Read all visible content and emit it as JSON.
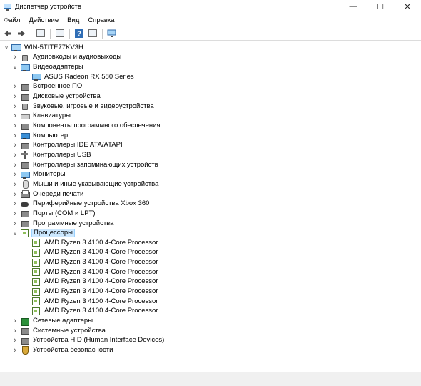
{
  "window": {
    "title": "Диспетчер устройств"
  },
  "menu": [
    "Файл",
    "Действие",
    "Вид",
    "Справка"
  ],
  "tree": {
    "root": "WIN-5TITE77KV3H",
    "items": [
      {
        "label": "Аудиовходы и аудиовыходы",
        "icon": "speaker-icon",
        "expanded": false,
        "level": 1
      },
      {
        "label": "Видеоадаптеры",
        "icon": "display-adapter-icon",
        "expanded": true,
        "level": 1
      },
      {
        "label": "ASUS Radeon RX 580 Series",
        "icon": "display-adapter-icon",
        "level": 2
      },
      {
        "label": "Встроенное ПО",
        "icon": "firmware-icon",
        "expanded": false,
        "level": 1
      },
      {
        "label": "Дисковые устройства",
        "icon": "disk-drive-icon",
        "expanded": false,
        "level": 1
      },
      {
        "label": "Звуковые, игровые и видеоустройства",
        "icon": "speaker-icon",
        "expanded": false,
        "level": 1
      },
      {
        "label": "Клавиатуры",
        "icon": "keyboard-icon",
        "expanded": false,
        "level": 1
      },
      {
        "label": "Компоненты программного обеспечения",
        "icon": "software-component-icon",
        "expanded": false,
        "level": 1
      },
      {
        "label": "Компьютер",
        "icon": "computer-icon",
        "expanded": false,
        "level": 1
      },
      {
        "label": "Контроллеры IDE ATA/ATAPI",
        "icon": "ide-controller-icon",
        "expanded": false,
        "level": 1
      },
      {
        "label": "Контроллеры USB",
        "icon": "usb-icon",
        "expanded": false,
        "level": 1
      },
      {
        "label": "Контроллеры запоминающих устройств",
        "icon": "storage-controller-icon",
        "expanded": false,
        "level": 1
      },
      {
        "label": "Мониторы",
        "icon": "monitor-icon",
        "expanded": false,
        "level": 1
      },
      {
        "label": "Мыши и иные указывающие устройства",
        "icon": "mouse-icon",
        "expanded": false,
        "level": 1
      },
      {
        "label": "Очереди печати",
        "icon": "printer-icon",
        "expanded": false,
        "level": 1
      },
      {
        "label": "Периферийные устройства Xbox 360",
        "icon": "gamepad-icon",
        "expanded": false,
        "level": 1
      },
      {
        "label": "Порты (COM и LPT)",
        "icon": "port-icon",
        "expanded": false,
        "level": 1
      },
      {
        "label": "Программные устройства",
        "icon": "software-device-icon",
        "expanded": false,
        "level": 1
      },
      {
        "label": "Процессоры",
        "icon": "processor-icon",
        "expanded": true,
        "selected": true,
        "level": 1
      },
      {
        "label": "AMD Ryzen 3 4100 4-Core Processor",
        "icon": "processor-icon",
        "level": 2
      },
      {
        "label": "AMD Ryzen 3 4100 4-Core Processor",
        "icon": "processor-icon",
        "level": 2
      },
      {
        "label": "AMD Ryzen 3 4100 4-Core Processor",
        "icon": "processor-icon",
        "level": 2
      },
      {
        "label": "AMD Ryzen 3 4100 4-Core Processor",
        "icon": "processor-icon",
        "level": 2
      },
      {
        "label": "AMD Ryzen 3 4100 4-Core Processor",
        "icon": "processor-icon",
        "level": 2
      },
      {
        "label": "AMD Ryzen 3 4100 4-Core Processor",
        "icon": "processor-icon",
        "level": 2
      },
      {
        "label": "AMD Ryzen 3 4100 4-Core Processor",
        "icon": "processor-icon",
        "level": 2
      },
      {
        "label": "AMD Ryzen 3 4100 4-Core Processor",
        "icon": "processor-icon",
        "level": 2
      },
      {
        "label": "Сетевые адаптеры",
        "icon": "network-adapter-icon",
        "expanded": false,
        "level": 1
      },
      {
        "label": "Системные устройства",
        "icon": "system-device-icon",
        "expanded": false,
        "level": 1
      },
      {
        "label": "Устройства HID (Human Interface Devices)",
        "icon": "hid-icon",
        "expanded": false,
        "level": 1
      },
      {
        "label": "Устройства безопасности",
        "icon": "security-device-icon",
        "expanded": false,
        "level": 1
      }
    ]
  },
  "colors": {
    "selection": "#cce8ff",
    "selection_border": "#99d1ff"
  }
}
